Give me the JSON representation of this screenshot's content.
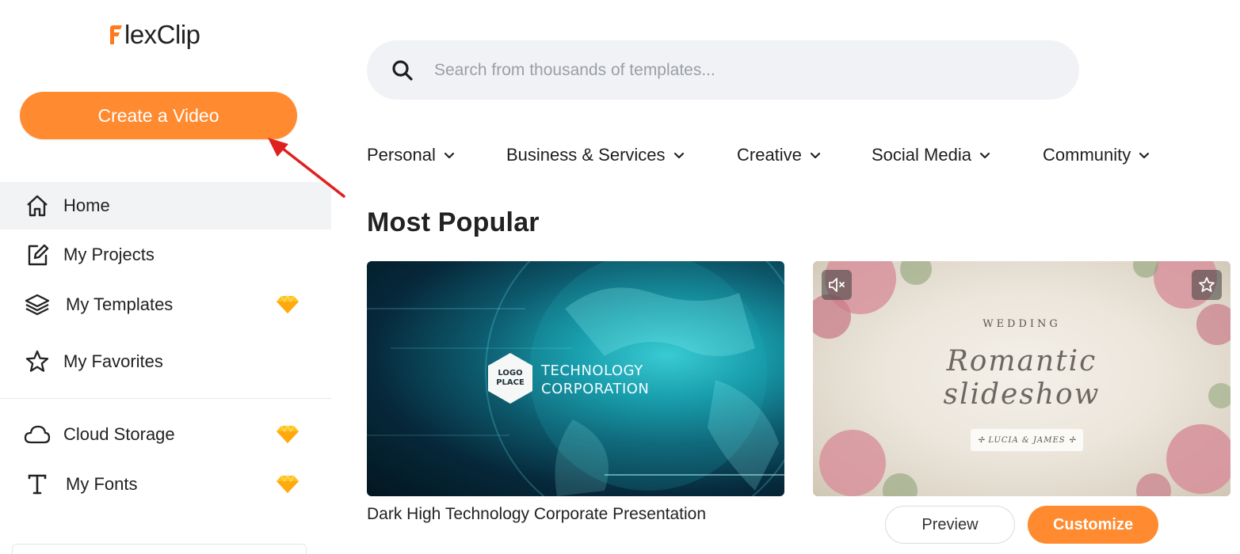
{
  "app": {
    "brand_name": "lexClip",
    "brand_color": "#ff8a2f"
  },
  "sidebar": {
    "create_button": "Create a Video",
    "items": [
      {
        "label": "Home",
        "icon": "home-icon",
        "active": true,
        "premium": false
      },
      {
        "label": "My Projects",
        "icon": "edit-icon",
        "active": false,
        "premium": false
      },
      {
        "label": "My Templates",
        "icon": "layers-icon",
        "active": false,
        "premium": true
      },
      {
        "label": "My Favorites",
        "icon": "star-outline-icon",
        "active": false,
        "premium": false
      },
      {
        "label": "Cloud Storage",
        "icon": "cloud-icon",
        "active": false,
        "premium": true
      },
      {
        "label": "My Fonts",
        "icon": "font-icon",
        "active": false,
        "premium": true
      }
    ]
  },
  "search": {
    "placeholder": "Search from thousands of templates..."
  },
  "categories": [
    {
      "label": "Personal"
    },
    {
      "label": "Business & Services"
    },
    {
      "label": "Creative"
    },
    {
      "label": "Social Media"
    },
    {
      "label": "Community"
    }
  ],
  "main": {
    "section_title": "Most Popular",
    "cards": [
      {
        "title": "Dark High Technology Corporate Presentation",
        "thumb_logo_line1": "LOGO",
        "thumb_logo_line2": "PLACE",
        "thumb_line1": "TECHNOLOGY",
        "thumb_line2": "CORPORATION"
      },
      {
        "thumb_small": "WEDDING",
        "thumb_script_line1": "Romantic",
        "thumb_script_line2": "slideshow",
        "thumb_names": "✢ LUCIA & JAMES ✢",
        "preview_label": "Preview",
        "customize_label": "Customize"
      }
    ]
  }
}
